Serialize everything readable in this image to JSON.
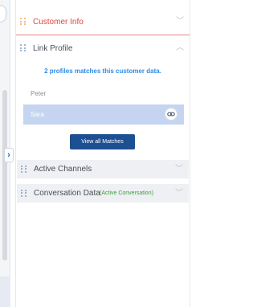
{
  "sections": {
    "customer_info": {
      "title": "Customer Info"
    },
    "link_profile": {
      "title": "Link Profile",
      "match_message": "2 profiles matches this customer data.",
      "profiles": [
        "Peter",
        "Sara"
      ],
      "view_button": "View all Matches"
    },
    "active_channels": {
      "title": "Active Channels"
    },
    "conversation_data": {
      "title": "Conversation Data",
      "tag": "(Active Conversation)"
    }
  },
  "colors": {
    "customer_title": "#e0463e",
    "match_text": "#2f8ae6",
    "selected_profile_bg": "#c5d5f1",
    "button_bg": "#1d4f93",
    "conv_tag": "#3f9a3a"
  },
  "icons": {
    "expand": "chevron-down-icon",
    "collapse": "chevron-up-icon",
    "drag": "drag-handle-icon",
    "link": "link-icon",
    "side_toggle": "chevron-right-icon"
  }
}
